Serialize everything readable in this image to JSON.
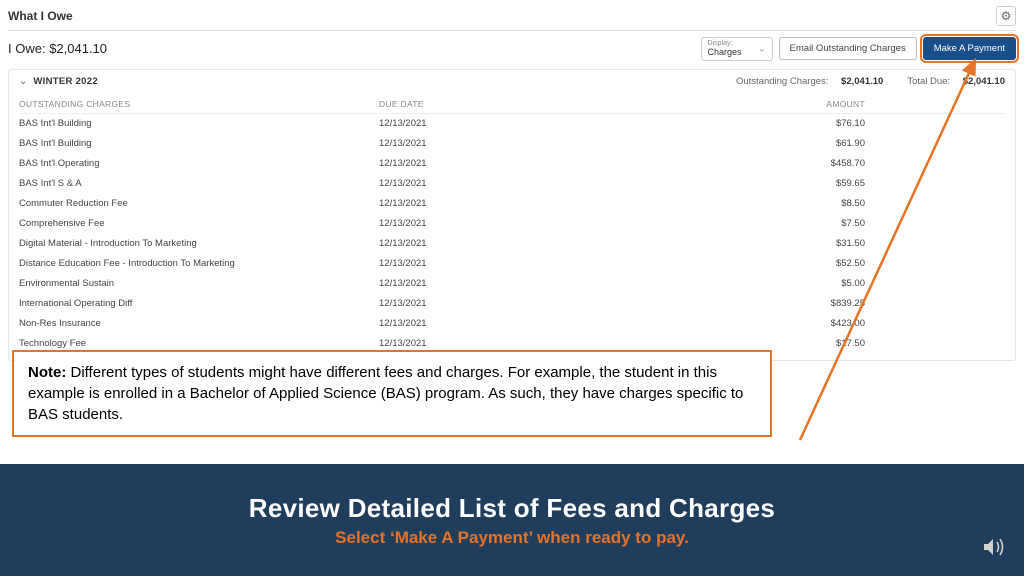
{
  "page": {
    "title": "What I Owe",
    "owe_label": "I Owe: ",
    "owe_amount": "$2,041.10"
  },
  "toolbar": {
    "display_label": "Display:",
    "display_value": "Charges",
    "email_btn": "Email Outstanding Charges",
    "payment_btn": "Make A Payment"
  },
  "term": {
    "name": "WINTER 2022",
    "outstanding_label": "Outstanding Charges:",
    "outstanding_value": "$2,041.10",
    "total_due_label": "Total Due:",
    "total_due_value": "$2,041.10"
  },
  "columns": {
    "c1": "OUTSTANDING CHARGES",
    "c2": "DUE DATE",
    "c3": "AMOUNT"
  },
  "rows": [
    {
      "name": "BAS Int'l Building",
      "due": "12/13/2021",
      "amt": "$76.10"
    },
    {
      "name": "BAS Int'l Building",
      "due": "12/13/2021",
      "amt": "$61.90"
    },
    {
      "name": "BAS Int'l Operating",
      "due": "12/13/2021",
      "amt": "$458.70"
    },
    {
      "name": "BAS Int'l S & A",
      "due": "12/13/2021",
      "amt": "$59.65"
    },
    {
      "name": "Commuter Reduction Fee",
      "due": "12/13/2021",
      "amt": "$8.50"
    },
    {
      "name": "Comprehensive Fee",
      "due": "12/13/2021",
      "amt": "$7.50"
    },
    {
      "name": "Digital Material - Introduction To Marketing",
      "due": "12/13/2021",
      "amt": "$31.50"
    },
    {
      "name": "Distance Education Fee - Introduction To Marketing",
      "due": "12/13/2021",
      "amt": "$52.50"
    },
    {
      "name": "Environmental Sustain",
      "due": "12/13/2021",
      "amt": "$5.00"
    },
    {
      "name": "International Operating Diff",
      "due": "12/13/2021",
      "amt": "$839.25"
    },
    {
      "name": "Non-Res Insurance",
      "due": "12/13/2021",
      "amt": "$423.00"
    },
    {
      "name": "Technology Fee",
      "due": "12/13/2021",
      "amt": "$17.50"
    }
  ],
  "note": {
    "label": "Note:",
    "text": " Different types of students might have different fees and charges. For example, the student in this example is enrolled in a Bachelor of Applied Science (BAS) program. As such, they have charges specific to BAS students."
  },
  "footer": {
    "title": "Review Detailed List of Fees and Charges",
    "sub": "Select ‘Make A Payment’ when ready to pay."
  }
}
